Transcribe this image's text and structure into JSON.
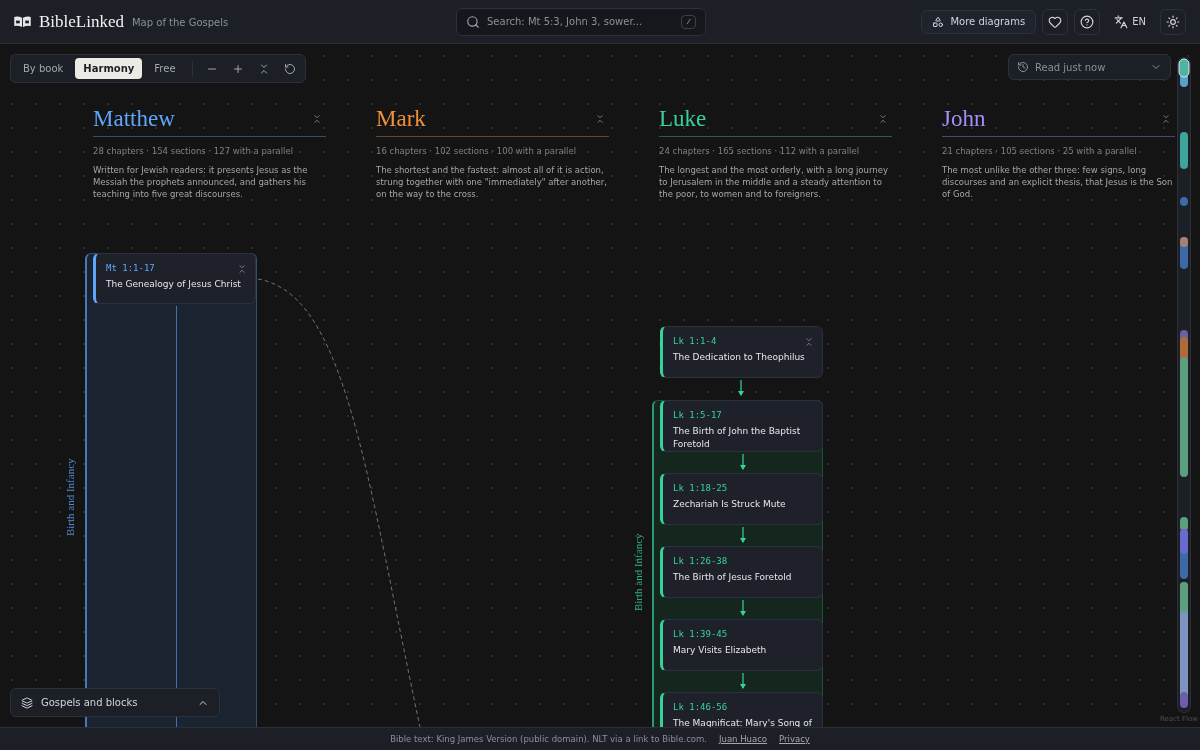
{
  "header": {
    "brand": "BibleLinked",
    "subtitle": "Map of the Gospels",
    "search": {
      "placeholder": "Search: Mt 5:3, John 3, sower...",
      "shortcut": "/"
    },
    "more_button": "More diagrams",
    "language": "EN"
  },
  "toolbar": {
    "modes": [
      {
        "label": "By book",
        "selected": false
      },
      {
        "label": "Harmony",
        "selected": true
      },
      {
        "label": "Free",
        "selected": false
      }
    ]
  },
  "read_select": {
    "value": "Read just now"
  },
  "gospels": [
    {
      "name": "Matthew",
      "color": "#60a5fa",
      "stats": "28 chapters · 154 sections · 127 with a parallel",
      "description": "Written for Jewish readers: it presents Jesus as the Messiah the prophets announced, and gathers his teaching into five great discourses."
    },
    {
      "name": "Mark",
      "color": "#f0913a",
      "stats": "16 chapters · 102 sections · 100 with a parallel",
      "description": "The shortest and the fastest: almost all of it is action, strung together with one \"immediately\" after another, on the way to the cross."
    },
    {
      "name": "Luke",
      "color": "#34d399",
      "stats": "24 chapters · 165 sections · 112 with a parallel",
      "description": "The longest and the most orderly, with a long journey to Jerusalem in the middle and a steady attention to the poor, to women and to foreigners."
    },
    {
      "name": "John",
      "color": "#a78bfa",
      "stats": "21 chapters · 105 sections · 25 with a parallel",
      "description": "The most unlike the other three: few signs, long discourses and an explicit thesis, that Jesus is the Son of God."
    }
  ],
  "matthew_block": {
    "label": "Birth and Infancy",
    "sections": [
      {
        "ref": "Mt 1:1-17",
        "title": "The Genealogy of Jesus Christ"
      }
    ]
  },
  "luke_intro": {
    "ref": "Lk 1:1-4",
    "title": "The Dedication to Theophilus"
  },
  "luke_block": {
    "label": "Birth and Infancy",
    "sections": [
      {
        "ref": "Lk 1:5-17",
        "title": "The Birth of John the Baptist Foretold"
      },
      {
        "ref": "Lk 1:18-25",
        "title": "Zechariah Is Struck Mute"
      },
      {
        "ref": "Lk 1:26-38",
        "title": "The Birth of Jesus Foretold"
      },
      {
        "ref": "Lk 1:39-45",
        "title": "Mary Visits Elizabeth"
      },
      {
        "ref": "Lk 1:46-56",
        "title": "The Magnificat: Mary's Song of"
      }
    ]
  },
  "layers_panel": {
    "label": "Gospels and blocks"
  },
  "attribution": "React Flow",
  "footer": {
    "text": "Bible text: King James Version (public domain). NLT via a link to Bible.com.",
    "links": [
      "Juan Huaco",
      "Privacy"
    ]
  }
}
